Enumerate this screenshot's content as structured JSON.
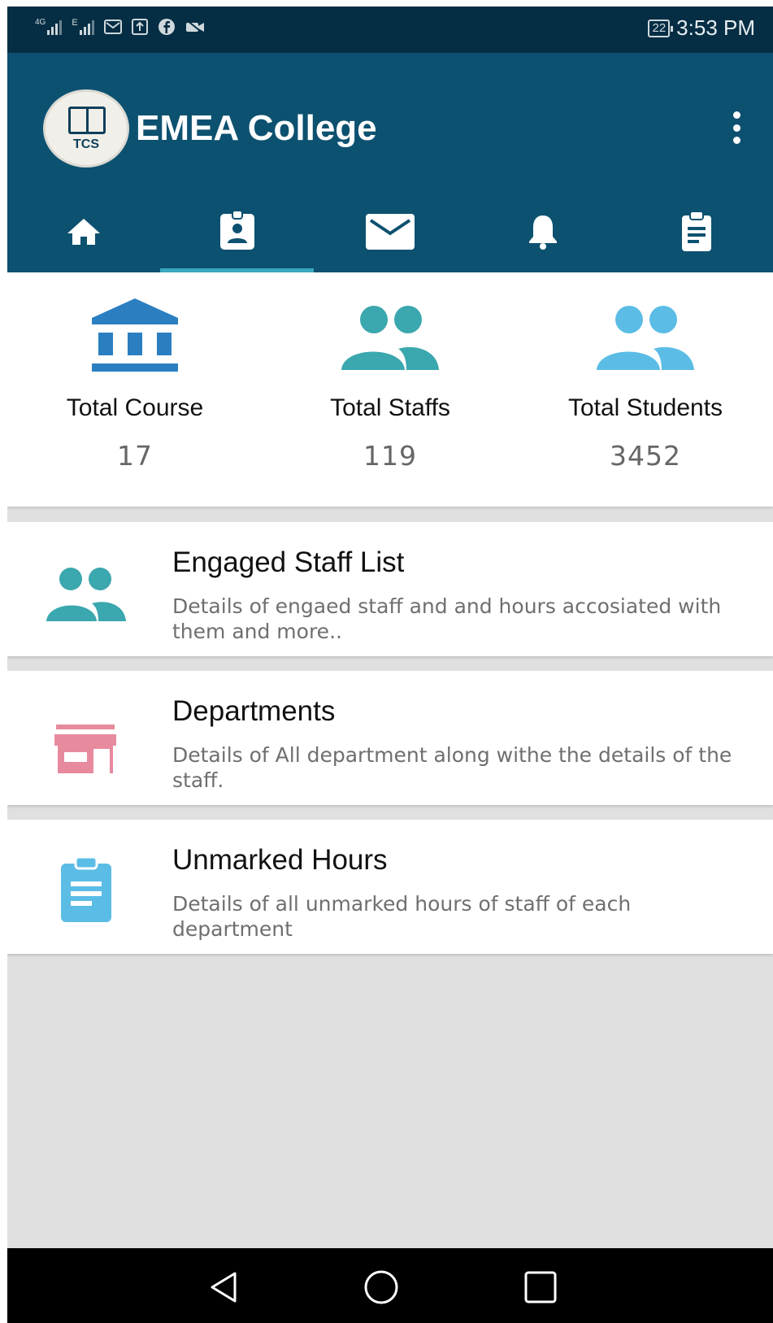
{
  "status_bar": {
    "network1": "4G",
    "network2": "E",
    "battery": "22",
    "time": "3:53 PM"
  },
  "header": {
    "logo_text": "TCS",
    "title": "EMEA College"
  },
  "tabs": [
    {
      "icon": "home-icon",
      "active": false
    },
    {
      "icon": "staff-badge-icon",
      "active": true
    },
    {
      "icon": "mail-icon",
      "active": false
    },
    {
      "icon": "bell-icon",
      "active": false
    },
    {
      "icon": "clipboard-icon",
      "active": false
    }
  ],
  "stats": [
    {
      "label": "Total Course",
      "value": "17",
      "icon": "institution-icon",
      "color": "#2b7fc1"
    },
    {
      "label": "Total Staffs",
      "value": "119",
      "icon": "people-icon",
      "color": "#3ba7ae"
    },
    {
      "label": "Total Students",
      "value": "3452",
      "icon": "people-icon",
      "color": "#5bbde6"
    }
  ],
  "list": [
    {
      "title": "Engaged Staff List",
      "description": "Details of engaed staff and and hours accosiated with them and more..",
      "icon": "people-icon",
      "color": "#3ba7ae"
    },
    {
      "title": "Departments",
      "description": "Details of All department along withe the details of the staff.",
      "icon": "store-icon",
      "color": "#e88a9e"
    },
    {
      "title": "Unmarked Hours",
      "description": "Details of all unmarked hours of staff of each department",
      "icon": "clipboard-icon",
      "color": "#5bbde6"
    }
  ],
  "colors": {
    "status_bar": "#052e44",
    "app_bar": "#0d5170",
    "tab_indicator": "#3aa8bf",
    "background": "#e0e0e0"
  }
}
